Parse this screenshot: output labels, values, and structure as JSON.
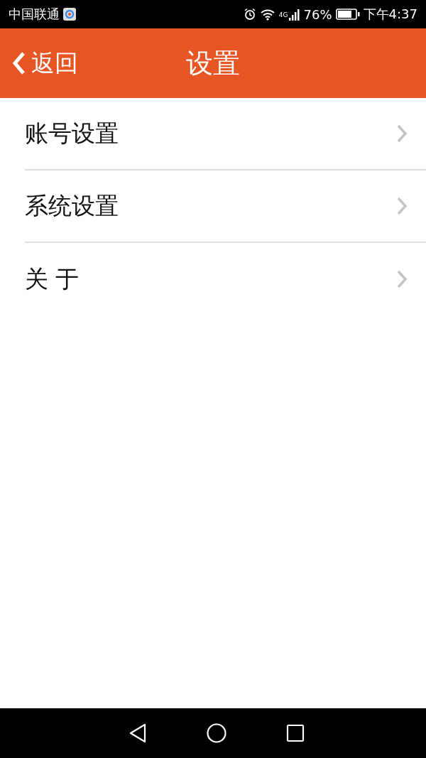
{
  "status_bar": {
    "carrier": "中国联通",
    "network": "4G",
    "battery": "76%",
    "time": "下午4:37"
  },
  "header": {
    "back": "返回",
    "title": "设置"
  },
  "items": [
    {
      "label": "账号设置"
    },
    {
      "label": "系统设置"
    },
    {
      "label": "关 于"
    }
  ]
}
